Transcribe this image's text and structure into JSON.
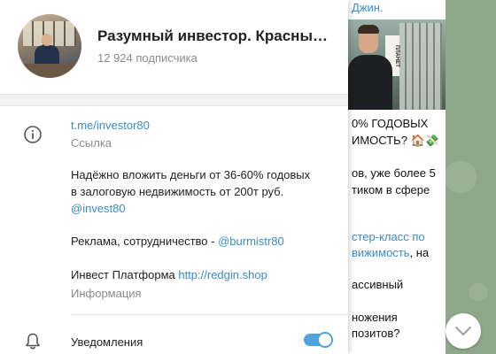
{
  "chat": {
    "author": "Джин.",
    "image_sign": "ПЛАНЕТ",
    "lines": [
      {
        "text": "0% ГОДОВЫХ",
        "link": false
      },
      {
        "text": "ИМОСТЬ? 🏠💸",
        "link": false
      },
      {
        "text": "ов, уже более 5",
        "link": false
      },
      {
        "text": "тиком в сфере",
        "link": false
      },
      {
        "text": "стер-класс по",
        "link": true
      },
      {
        "text": "вижимость",
        "link": true
      },
      {
        "text": ", на",
        "link": false
      },
      {
        "text": "ассивный",
        "link": false
      },
      {
        "text": "ножения",
        "link": false
      },
      {
        "text": "позитов?",
        "link": false
      }
    ]
  },
  "channel": {
    "title": "Разумный инвестор. Красный ...",
    "subscribers": "12 924 подписчика"
  },
  "info": {
    "link": "t.me/investor80",
    "link_label": "Ссылка",
    "desc_line1": "Надёжно вложить деньги от 36-60% годовых",
    "desc_line2": "в залоговую недвижимость от 200т руб.",
    "desc_mention": "@invest80",
    "ads_text": "Реклама, сотрудничество - ",
    "ads_mention": "@burmistr80",
    "platform_text": "Инвест Платформа ",
    "platform_link": "http://redgin.shop",
    "info_label": "Информация"
  },
  "notifications": {
    "label": "Уведомления",
    "enabled": true
  },
  "colors": {
    "accent": "#3a8bc7",
    "toggle": "#4ea4dc"
  },
  "icons": {
    "info": "info-icon",
    "bell": "bell-icon",
    "scroll": "chevron-down-icon"
  }
}
